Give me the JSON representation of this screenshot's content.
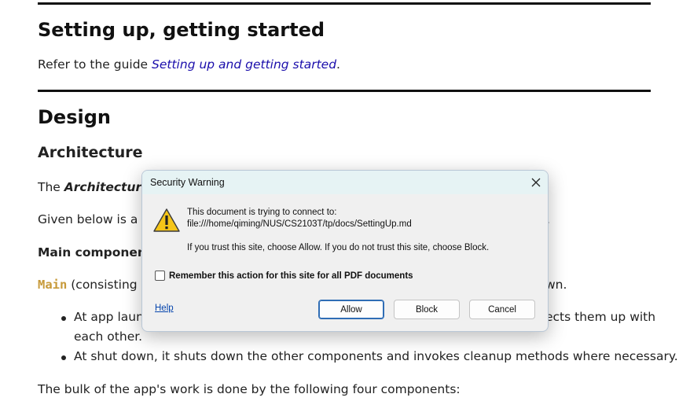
{
  "document": {
    "setup_heading": "Setting up, getting started",
    "setup_text": "Refer to the guide ",
    "setup_link": "Setting up and getting started",
    "setup_suffix": ".",
    "design_heading": "Design",
    "architecture_heading": "Architecture",
    "arch_para_prefix": "The ",
    "arch_para_bold": "Architecture L",
    "given_below_visible": "Given below is a qu",
    "given_below_end": "r.",
    "main_components": "Main components",
    "main_code": "Main",
    "main_consisting": " (consisting o",
    "main_end": "wn.",
    "bullet1_start": "At app launc",
    "bullet1_end": "ects them up with",
    "bullet1_line2": "each other.",
    "bullet2": "At shut down, it shuts down the other components and invokes cleanup methods where necessary.",
    "bulk_text": "The bulk of the app's work is done by the following four components:"
  },
  "dialog": {
    "title": "Security Warning",
    "message_line1": "This document is trying to connect to:",
    "message_url": "file:///home/qiming/NUS/CS2103T/tp/docs/SettingUp.md",
    "message_trust": "If you trust this site, choose Allow. If you do not trust this site, choose Block.",
    "remember_label": "Remember this action for this site for all PDF documents",
    "remember_checked": false,
    "help_link": "Help",
    "allow_button": "Allow",
    "block_button": "Block",
    "cancel_button": "Cancel",
    "icon": "warning-icon",
    "close_icon": "close-icon"
  }
}
